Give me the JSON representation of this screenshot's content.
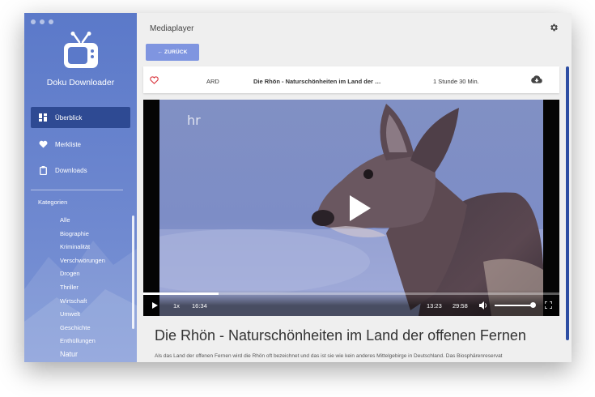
{
  "app": {
    "name": "Doku Downloader",
    "accent": "#2e4a93"
  },
  "sidebar": {
    "nav": [
      {
        "label": "Überblick",
        "icon": "dashboard-icon",
        "active": true
      },
      {
        "label": "Merkliste",
        "icon": "heart-icon"
      },
      {
        "label": "Downloads",
        "icon": "clipboard-icon"
      }
    ],
    "categories_heading": "Kategorien",
    "categories": [
      "Alle",
      "Biographie",
      "Kriminalität",
      "Verschwörungen",
      "Drogen",
      "Thriller",
      "Wirtschaft",
      "Umwelt",
      "Geschichte",
      "Enthüllungen",
      "Natur"
    ],
    "selected_category": "Natur"
  },
  "header": {
    "title": "Mediaplayer",
    "back_label": "← ZURÜCK"
  },
  "video": {
    "channel": "ARD",
    "title": "Die Rhön - Naturschönheiten im Land der off...",
    "duration": "1 Stunde 30 Min.",
    "full_title": "Die Rhön - Naturschönheiten im Land der offenen Fernen",
    "description": "Als das Land der offenen Fernen wird die Rhön oft bezeichnet und das ist sie wie kein anderes Mittelgebirge in Deutschland. Das Biosphärenreservat",
    "watermark": "hr"
  },
  "player": {
    "speed": "1x",
    "position": "16:34",
    "elapsed": "13:23",
    "remaining": "29:58",
    "progress": 0.18,
    "volume": 0.95
  }
}
